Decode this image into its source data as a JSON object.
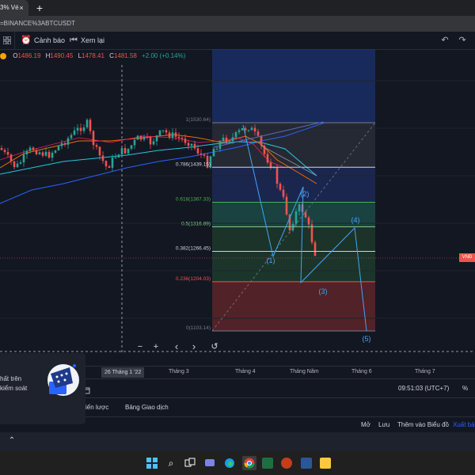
{
  "browser": {
    "tab_title": "3% Vé",
    "tab_close": "×",
    "new_tab": "+",
    "url": "=BINANCE%3ABTCUSDT"
  },
  "toolbar": {
    "layout_icon": "grid-icon",
    "alert_label": "Cảnh báo",
    "replay_label": "Xem lại",
    "undo_icon": "undo-icon",
    "redo_icon": "redo-icon",
    "fullscreen_icon": "fullscreen-icon"
  },
  "ohlc": {
    "o_label": "O",
    "o_value": "1486.19",
    "h_label": "H",
    "h_value": "1490.45",
    "l_label": "L",
    "l_value": "1478.41",
    "c_label": "C",
    "c_value": "1481.58",
    "change": "+2.00 (+0.14%)"
  },
  "fib_levels": [
    {
      "label": "1(1530.64)",
      "price": 1530.64,
      "color": "#787b86"
    },
    {
      "label": "0.786(1439.15)",
      "price": 1439.15,
      "color": "#d1d4dc"
    },
    {
      "label": "0.618(1367.33)",
      "price": 1367.33,
      "color": "#4caf50"
    },
    {
      "label": "0.5(1316.89)",
      "price": 1316.89,
      "color": "#81c784"
    },
    {
      "label": "0.382(1266.45)",
      "price": 1266.45,
      "color": "#d1d4dc"
    },
    {
      "label": "0.236(1204.03)",
      "price": 1204.03,
      "color": "#ef5350"
    },
    {
      "label": "0(1103.14)",
      "price": 1103.14,
      "color": "#787b86"
    }
  ],
  "waves": [
    {
      "label": "(1)"
    },
    {
      "label": "(2)"
    },
    {
      "label": "(3)"
    },
    {
      "label": "(4)"
    },
    {
      "label": "(5)"
    }
  ],
  "x_axis": {
    "ticks": [
      "Tháng 3",
      "Tháng 4",
      "Tháng Năm",
      "Tháng 6",
      "Tháng 7"
    ],
    "crosshair_label": "26 Tháng 1 '22"
  },
  "price_tag": "VNĐ",
  "nav_controls": {
    "minus": "−",
    "plus": "+",
    "left": "‹",
    "right": "›",
    "reset": "↺"
  },
  "bottom": {
    "range_icon": "calendar-icon",
    "time": "09:51:03 (UTC+7)",
    "percent": "%"
  },
  "panel_tabs": [
    "iến lược",
    "Bảng Giao dịch"
  ],
  "actions": [
    "Mở",
    "Lưu",
    "Thêm vào Biểu đồ",
    "Xuất bản"
  ],
  "popup": {
    "line1": "hất trên",
    "line2": "kiểm soát"
  },
  "collapse_icon": "chevron-up-icon",
  "taskbar": {
    "icons": [
      "windows-icon",
      "search-icon",
      "task-view-icon",
      "chat-icon",
      "edge-icon",
      "chrome-icon",
      "excel-icon",
      "powerpoint-icon",
      "word-icon",
      "explorer-icon"
    ]
  },
  "colors": {
    "bg": "#131722",
    "up": "#26a69a",
    "down": "#ef5350",
    "accent": "#2962ff"
  }
}
